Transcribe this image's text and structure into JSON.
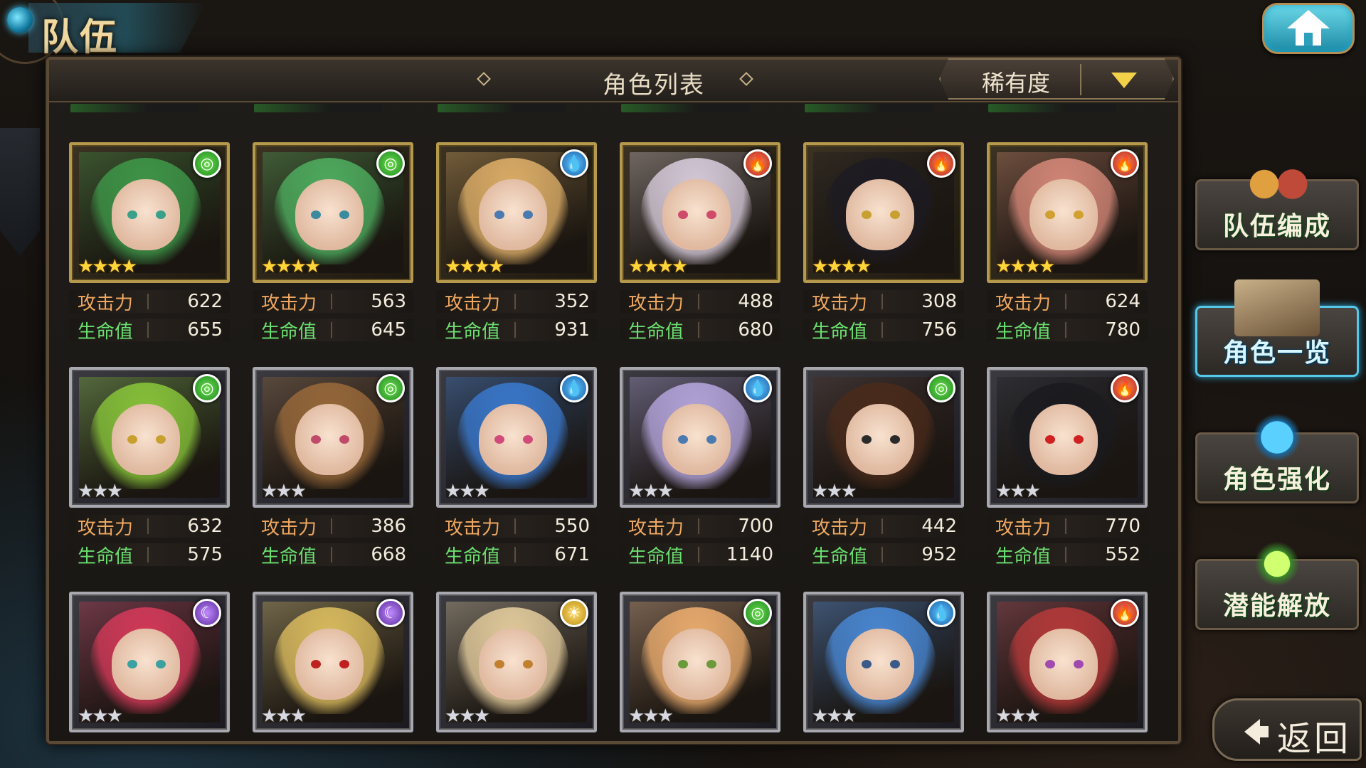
{
  "header": {
    "title": "队伍",
    "panel_title": "角色列表",
    "sort_label": "稀有度",
    "home_icon": "home-icon"
  },
  "stat_labels": {
    "attack": "攻击力",
    "hp": "生命值"
  },
  "cards": [
    {
      "element": "wind",
      "rarity": 4,
      "attack": "622",
      "hp": "655",
      "hair": "#3f9a4a",
      "eye": "#3aa08a",
      "frame": "gold"
    },
    {
      "element": "wind",
      "rarity": 4,
      "attack": "563",
      "hp": "645",
      "hair": "#4fb060",
      "eye": "#3a8aa0",
      "frame": "gold"
    },
    {
      "element": "water",
      "rarity": 4,
      "attack": "352",
      "hp": "931",
      "hair": "#e2b26a",
      "eye": "#4a7ab0",
      "frame": "gold"
    },
    {
      "element": "fire",
      "rarity": 4,
      "attack": "488",
      "hp": "680",
      "hair": "#dcd0e0",
      "eye": "#d04a6a",
      "frame": "gold"
    },
    {
      "element": "fire",
      "rarity": 4,
      "attack": "308",
      "hp": "756",
      "hair": "#1c1a22",
      "eye": "#c8a030",
      "frame": "gold"
    },
    {
      "element": "fire",
      "rarity": 4,
      "attack": "624",
      "hp": "780",
      "hair": "#d88a7a",
      "eye": "#d0a030",
      "frame": "gold"
    },
    {
      "element": "wind",
      "rarity": 3,
      "attack": "632",
      "hp": "575",
      "hair": "#8ac83a",
      "eye": "#c8a030",
      "frame": "silver"
    },
    {
      "element": "wind",
      "rarity": 3,
      "attack": "386",
      "hp": "668",
      "hair": "#9a6a3a",
      "eye": "#c04a6a",
      "frame": "silver"
    },
    {
      "element": "water",
      "rarity": 3,
      "attack": "550",
      "hp": "671",
      "hair": "#3a7ad0",
      "eye": "#d04a7a",
      "frame": "silver"
    },
    {
      "element": "water",
      "rarity": 3,
      "attack": "700",
      "hp": "1140",
      "hair": "#b8a8e0",
      "eye": "#4a7ab0",
      "frame": "silver"
    },
    {
      "element": "wind",
      "rarity": 3,
      "attack": "442",
      "hp": "952",
      "hair": "#4a2a1a",
      "eye": "#2a2a2a",
      "frame": "silver"
    },
    {
      "element": "fire",
      "rarity": 3,
      "attack": "770",
      "hp": "552",
      "hair": "#1a1a1e",
      "eye": "#d02020",
      "frame": "silver"
    },
    {
      "element": "dark",
      "rarity": 3,
      "hair": "#d83a5a",
      "eye": "#3aa0a0",
      "frame": "silver"
    },
    {
      "element": "dark",
      "rarity": 3,
      "hair": "#e0c060",
      "eye": "#c02020",
      "frame": "silver"
    },
    {
      "element": "light",
      "rarity": 3,
      "hair": "#e8d0a0",
      "eye": "#c08030",
      "frame": "silver"
    },
    {
      "element": "wind",
      "rarity": 3,
      "hair": "#f0b070",
      "eye": "#6a9a3a",
      "frame": "silver"
    },
    {
      "element": "water",
      "rarity": 3,
      "hair": "#4a8ad8",
      "eye": "#3a5a8a",
      "frame": "silver"
    },
    {
      "element": "fire",
      "rarity": 3,
      "hair": "#b83a3a",
      "eye": "#a04ab0",
      "frame": "silver"
    }
  ],
  "element_glyphs": {
    "wind": "◎",
    "water": "💧",
    "fire": "🔥",
    "dark": "☾",
    "light": "☀"
  },
  "side_menu": [
    {
      "label": "队伍编成",
      "icon": "team-characters-icon",
      "active": false
    },
    {
      "label": "角色一览",
      "icon": "book-icon",
      "active": true
    },
    {
      "label": "角色强化",
      "icon": "crystal-icon",
      "active": false
    },
    {
      "label": "潜能解放",
      "icon": "orb-icon",
      "active": false
    }
  ],
  "back_label": "返回",
  "colors": {
    "attack_label": "#f0a860",
    "hp_label": "#6be070",
    "gold_frame": "#b59a4e",
    "silver_frame": "#a8a8b0"
  }
}
